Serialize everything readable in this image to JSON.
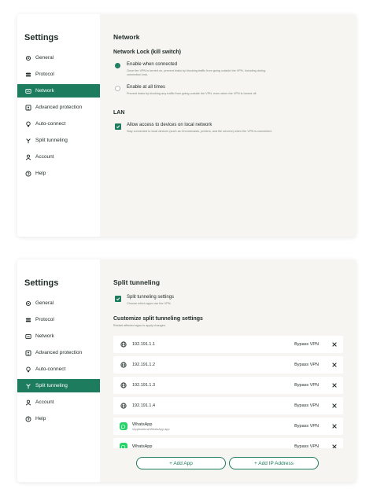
{
  "panel1": {
    "sidebar": {
      "title": "Settings",
      "items": [
        {
          "label": "General",
          "icon": "gear-icon",
          "active": false
        },
        {
          "label": "Protocol",
          "icon": "protocol-icon",
          "active": false
        },
        {
          "label": "Network",
          "icon": "network-icon",
          "active": true
        },
        {
          "label": "Advanced protection",
          "icon": "shield-icon",
          "active": false
        },
        {
          "label": "Auto-connect",
          "icon": "bulb-icon",
          "active": false
        },
        {
          "label": "Split tunneling",
          "icon": "split-icon",
          "active": false
        },
        {
          "label": "Account",
          "icon": "user-icon",
          "active": false
        },
        {
          "label": "Help",
          "icon": "help-icon",
          "active": false
        }
      ]
    },
    "content": {
      "title": "Network",
      "network_lock": {
        "heading": "Network Lock (kill switch)",
        "options": [
          {
            "label": "Enable when connected",
            "desc": "Once the VPN is turned on, prevent leaks by blocking traffic from going outside the VPN, including during connection loss.",
            "selected": true
          },
          {
            "label": "Enable at all times",
            "desc": "Prevent leaks by blocking any traffic from going outside the VPN, even when the VPN is turned off.",
            "selected": false
          }
        ]
      },
      "lan": {
        "heading": "LAN",
        "option": {
          "label": "Allow access to devices on local network",
          "desc": "Stay connected to local devices (such as Chromecasts, printers, and file servers) when the VPN is connected.",
          "checked": true
        }
      }
    }
  },
  "panel2": {
    "sidebar": {
      "title": "Settings",
      "items": [
        {
          "label": "General",
          "icon": "gear-icon",
          "active": false
        },
        {
          "label": "Protocol",
          "icon": "protocol-icon",
          "active": false
        },
        {
          "label": "Network",
          "icon": "network-icon",
          "active": false
        },
        {
          "label": "Advanced protection",
          "icon": "shield-icon",
          "active": false
        },
        {
          "label": "Auto-connect",
          "icon": "bulb-icon",
          "active": false
        },
        {
          "label": "Split tunneling",
          "icon": "split-icon",
          "active": true
        },
        {
          "label": "Account",
          "icon": "user-icon",
          "active": false
        },
        {
          "label": "Help",
          "icon": "help-icon",
          "active": false
        }
      ]
    },
    "content": {
      "title": "Split tunneling",
      "toggle": {
        "label": "Split tunneling settings",
        "desc": "Choose which apps use the VPN.",
        "checked": true
      },
      "customize": {
        "heading": "Customize split tunneling settings",
        "desc": "Restart affected apps to apply changes."
      },
      "rows": [
        {
          "type": "ip",
          "name": "192.191.1.1",
          "sub": "",
          "action": "Bypass VPN"
        },
        {
          "type": "ip",
          "name": "192.191.1.2",
          "sub": "",
          "action": "Bypass VPN"
        },
        {
          "type": "ip",
          "name": "192.191.1.3",
          "sub": "",
          "action": "Bypass VPN"
        },
        {
          "type": "ip",
          "name": "192.191.1.4",
          "sub": "",
          "action": "Bypass VPN"
        },
        {
          "type": "app",
          "name": "WhatsApp",
          "sub": "/Applications/WhatsApp.app",
          "action": "Bypass VPN"
        },
        {
          "type": "app",
          "name": "WhatsApp",
          "sub": "",
          "action": "Bypass VPN"
        }
      ],
      "add_app_label": "+ Add App",
      "add_ip_label": "+ Add IP Address"
    }
  },
  "colors": {
    "accent": "#1d7b5e",
    "panel_bg": "#f6f5f1",
    "sidebar_bg": "#ffffff",
    "muted_text": "#7d837f"
  }
}
